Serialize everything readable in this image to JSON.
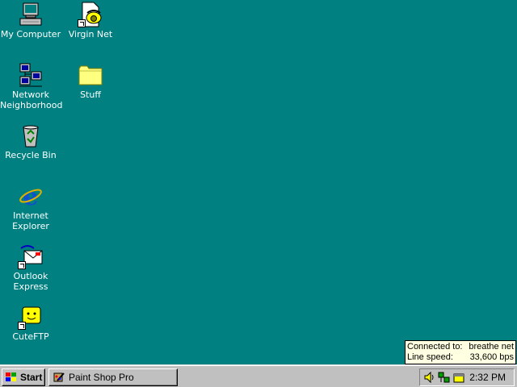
{
  "desktop": {
    "icons": [
      {
        "label": "My Computer",
        "icon": "my-computer-icon"
      },
      {
        "label": "Virgin Net",
        "icon": "phone-dialer-icon"
      },
      {
        "label": "Network\nNeighborhood",
        "icon": "network-icon"
      },
      {
        "label": "Stuff",
        "icon": "folder-icon"
      },
      {
        "label": "Recycle Bin",
        "icon": "recycle-bin-icon"
      },
      {
        "label": "Internet\nExplorer",
        "icon": "internet-explorer-icon"
      },
      {
        "label": "Outlook\nExpress",
        "icon": "outlook-express-icon"
      },
      {
        "label": "CuteFTP",
        "icon": "cuteftp-icon"
      }
    ]
  },
  "tooltip": {
    "connected_label": "Connected to:",
    "connected_value": "breathe net",
    "speed_label": "Line speed:",
    "speed_value": "33,600 bps"
  },
  "taskbar": {
    "start_label": "Start",
    "task_label": "Paint Shop Pro",
    "clock": "2:32 PM"
  },
  "colors": {
    "desktop": "#008080",
    "taskbar": "#c0c0c0",
    "tooltip_bg": "#ffffe1"
  }
}
